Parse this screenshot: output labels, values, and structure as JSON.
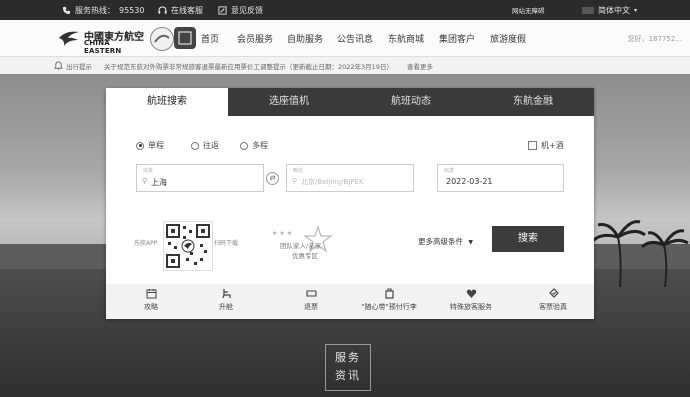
{
  "topbar": {
    "hotline_label": "服务热线：",
    "hotline_number": "95530",
    "online_service": "在线客服",
    "feedback": "意见反馈",
    "corp_link": "网站无障碍",
    "language": "简体中文"
  },
  "header": {
    "logo_cn": "中國東方航空",
    "logo_en": "CHINA EASTERN",
    "nav": [
      "首页",
      "会员服务",
      "自助服务",
      "公告讯息",
      "东航商城",
      "集团客户",
      "旅游度假"
    ],
    "greeting": "您好，187752..."
  },
  "notice": {
    "label": "出行提示",
    "text": "关于规范东航对外购票非常规旅客退票最新应用票价工调整提示（更新截止日期：2022年3月19日）",
    "more": "查看更多"
  },
  "booking": {
    "tabs": [
      "航班搜索",
      "选座值机",
      "航班动态",
      "东航金融"
    ],
    "trip_types": [
      "单程",
      "往返",
      "多程"
    ],
    "selected_trip": "单程",
    "hotel_combo": "机+酒",
    "from_label": "出发",
    "from_value": "上海",
    "to_label": "到达",
    "to_placeholder": "北京/Beijing/BJPEK",
    "date_label": "出发",
    "date_value": "2022-03-21",
    "qr_left": "东航APP",
    "qr_right": "扫码下载",
    "promo_line1": "团队家人/亲家",
    "promo_line2": "优惠专区",
    "more_conditions": "更多高级条件",
    "search_button": "搜索"
  },
  "services": [
    {
      "label": "攻略",
      "icon": "calendar-icon"
    },
    {
      "label": "升舱",
      "icon": "seat-icon"
    },
    {
      "label": "退票",
      "icon": "ticket-icon"
    },
    {
      "label": "\"随心带\"预付行李",
      "icon": "luggage-icon"
    },
    {
      "label": "特殊旅客服务",
      "icon": "heart-icon"
    },
    {
      "label": "客票验真",
      "icon": "ticket-check-icon"
    }
  ],
  "news": {
    "line1": "服务",
    "line2": "资讯"
  }
}
